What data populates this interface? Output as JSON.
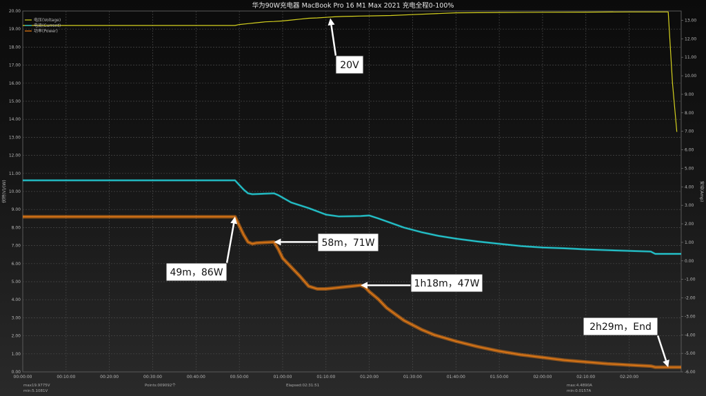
{
  "chart_data": {
    "type": "line",
    "title": "华为90W充电器 MacBook Pro 16 M1 Max 2021 充电全程0-100%",
    "ylabel_left": "伏特(V)/(W)",
    "ylabel_right": "安培(Amp)",
    "ylim_left": [
      0,
      20
    ],
    "ylim_right": [
      -6,
      13.5
    ],
    "yticks_left": [
      "0.00",
      "1.00",
      "2.00",
      "3.00",
      "4.00",
      "5.00",
      "6.00",
      "7.00",
      "8.00",
      "9.00",
      "10.00",
      "11.00",
      "12.00",
      "13.00",
      "14.00",
      "15.00",
      "16.00",
      "17.00",
      "18.00",
      "19.00",
      "20.00"
    ],
    "yticks_right": [
      "-6.00",
      "-5.00",
      "-4.00",
      "-3.00",
      "-2.00",
      "-1.00",
      "0.00",
      "1.00",
      "2.00",
      "3.00",
      "4.00",
      "5.00",
      "6.00",
      "7.00",
      "8.00",
      "9.00",
      "10.00",
      "11.00",
      "12.00",
      "13.00"
    ],
    "xticks": [
      "00:00:00",
      "00:10:00",
      "00:20:00",
      "00:30:00",
      "00:40:00",
      "00:50:00",
      "01:00:00",
      "01:10:00",
      "01:20:00",
      "01:30:00",
      "01:40:00",
      "01:50:00",
      "02:00:00",
      "02:10:00",
      "02:20:00"
    ],
    "x_unit": "minutes",
    "xlim": [
      0,
      152
    ],
    "legend": {
      "position": "top-left"
    },
    "grid": true,
    "series": [
      {
        "name": "电压(Voltage)",
        "axis": "left",
        "color": "#d6d21e",
        "x": [
          0,
          49,
          50,
          52,
          54,
          56,
          58,
          60,
          62,
          64,
          66,
          68,
          70,
          72,
          74,
          76,
          78,
          80,
          85,
          90,
          95,
          100,
          110,
          120,
          130,
          140,
          149,
          150,
          151
        ],
        "y": [
          19.2,
          19.2,
          19.25,
          19.3,
          19.35,
          19.4,
          19.42,
          19.45,
          19.5,
          19.55,
          19.6,
          19.62,
          19.65,
          19.68,
          19.7,
          19.71,
          19.72,
          19.73,
          19.75,
          19.8,
          19.85,
          19.9,
          19.92,
          19.93,
          19.94,
          19.95,
          19.95,
          16.0,
          13.3
        ]
      },
      {
        "name": "电流(Current)",
        "axis": "right",
        "color": "#25d6df",
        "x": [
          0,
          49,
          50,
          51,
          52,
          53,
          58,
          59,
          62,
          66,
          70,
          73,
          78,
          80,
          82,
          85,
          88,
          92,
          96,
          100,
          105,
          110,
          115,
          120,
          125,
          130,
          135,
          140,
          145,
          146,
          152
        ],
        "y": [
          4.35,
          4.35,
          4.1,
          3.85,
          3.65,
          3.6,
          3.65,
          3.55,
          3.15,
          2.85,
          2.5,
          2.4,
          2.42,
          2.45,
          2.3,
          2.05,
          1.8,
          1.55,
          1.35,
          1.2,
          1.05,
          0.92,
          0.8,
          0.72,
          0.68,
          0.62,
          0.58,
          0.54,
          0.5,
          0.38,
          0.38
        ]
      },
      {
        "name": "功率(Power)",
        "axis": "left",
        "color": "#f07f14",
        "x": [
          0,
          49,
          50,
          51,
          52,
          53,
          54,
          58,
          59,
          60,
          62,
          64,
          66,
          68,
          70,
          72,
          78,
          79,
          80,
          82,
          84,
          86,
          88,
          90,
          92,
          95,
          100,
          105,
          110,
          115,
          120,
          125,
          130,
          135,
          140,
          145,
          146,
          152
        ],
        "y": [
          8.6,
          8.6,
          8.1,
          7.6,
          7.2,
          7.1,
          7.15,
          7.2,
          6.8,
          6.3,
          5.8,
          5.3,
          4.75,
          4.6,
          4.6,
          4.65,
          4.8,
          4.7,
          4.45,
          4.05,
          3.55,
          3.2,
          2.85,
          2.6,
          2.35,
          2.05,
          1.7,
          1.4,
          1.15,
          0.95,
          0.8,
          0.65,
          0.55,
          0.45,
          0.38,
          0.32,
          0.26,
          0.26
        ]
      }
    ],
    "annotations": [
      {
        "text": "20V",
        "x": 71,
        "y": 19.6,
        "axis": "left"
      },
      {
        "text": "49m，86W",
        "x": 49,
        "y": 8.6,
        "axis": "left"
      },
      {
        "text": "58m，71W",
        "x": 58,
        "y": 7.2,
        "axis": "left"
      },
      {
        "text": "1h18m，47W",
        "x": 78,
        "y": 4.8,
        "axis": "left"
      },
      {
        "text": "2h29m，End",
        "x": 149,
        "y": 0.26,
        "axis": "left"
      }
    ],
    "stats": {
      "max_voltage": "max19.9775V",
      "min_voltage": "min:5.1081V",
      "points": "Points:009092个",
      "elapsed": "Elapsed:02:31:51",
      "max_current": "max:4.4890A",
      "min_current": "min:0.0157A"
    }
  }
}
